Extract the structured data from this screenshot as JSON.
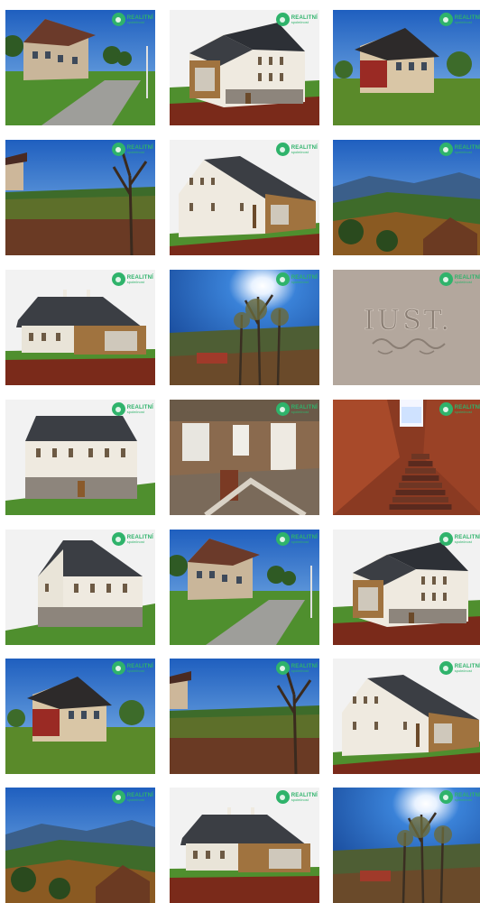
{
  "gallery": {
    "watermark": {
      "brand": "REALITNÍ",
      "sub": "společnost"
    },
    "stone_inscription": "IUST.",
    "colors": {
      "brand_green": "#2fb36b",
      "sky": "#2b6fc7",
      "roof": "#3b3e44",
      "grass": "#4f8f2e",
      "soil": "#7a2a1a"
    },
    "items": [
      {
        "kind": "photo-house-road"
      },
      {
        "kind": "render-house-wood"
      },
      {
        "kind": "photo-house-red"
      },
      {
        "kind": "photo-garden"
      },
      {
        "kind": "render-house-front"
      },
      {
        "kind": "photo-valley"
      },
      {
        "kind": "render-house-side"
      },
      {
        "kind": "photo-sun-trees"
      },
      {
        "kind": "photo-stone-inscription"
      },
      {
        "kind": "render-house-facade"
      },
      {
        "kind": "photo-interior"
      },
      {
        "kind": "photo-brick-stairs"
      },
      {
        "kind": "render-house-corner"
      },
      {
        "kind": "photo-house-road"
      },
      {
        "kind": "render-house-wood"
      },
      {
        "kind": "photo-house-red"
      },
      {
        "kind": "photo-garden"
      },
      {
        "kind": "render-house-front"
      },
      {
        "kind": "photo-valley"
      },
      {
        "kind": "render-house-side"
      },
      {
        "kind": "photo-sun-trees"
      }
    ]
  }
}
